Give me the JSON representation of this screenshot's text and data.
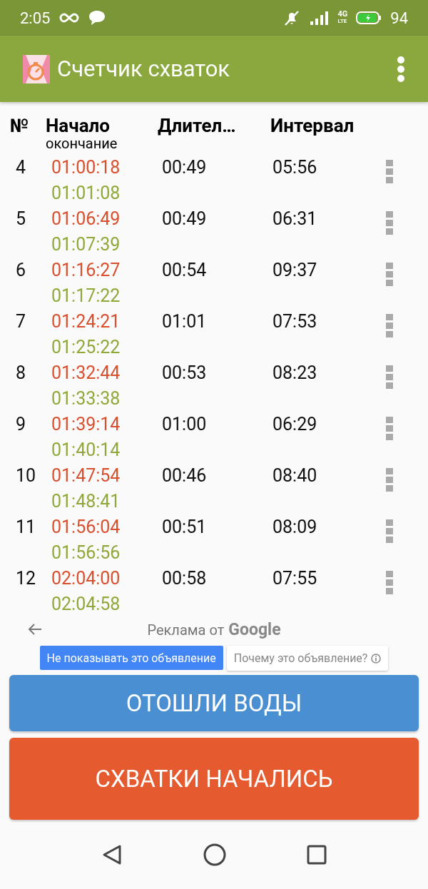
{
  "status_bar": {
    "time": "2:05",
    "network": "4G",
    "network_sub": "LTE",
    "battery": "94"
  },
  "app_bar": {
    "title": "Счетчик схваток"
  },
  "table": {
    "columns": [
      {
        "label": "№"
      },
      {
        "label": "Начало",
        "sublabel": "окончание"
      },
      {
        "label": "Длител…"
      },
      {
        "label": "Интервал"
      }
    ],
    "rows": [
      {
        "number": "4",
        "start": "01:00:18",
        "end": "01:01:08",
        "duration": "00:49",
        "interval": "05:56"
      },
      {
        "number": "5",
        "start": "01:06:49",
        "end": "01:07:39",
        "duration": "00:49",
        "interval": "06:31"
      },
      {
        "number": "6",
        "start": "01:16:27",
        "end": "01:17:22",
        "duration": "00:54",
        "interval": "09:37"
      },
      {
        "number": "7",
        "start": "01:24:21",
        "end": "01:25:22",
        "duration": "01:01",
        "interval": "07:53"
      },
      {
        "number": "8",
        "start": "01:32:44",
        "end": "01:33:38",
        "duration": "00:53",
        "interval": "08:23"
      },
      {
        "number": "9",
        "start": "01:39:14",
        "end": "01:40:14",
        "duration": "01:00",
        "interval": "06:29"
      },
      {
        "number": "10",
        "start": "01:47:54",
        "end": "01:48:41",
        "duration": "00:46",
        "interval": "08:40"
      },
      {
        "number": "11",
        "start": "01:56:04",
        "end": "01:56:56",
        "duration": "00:51",
        "interval": "08:09"
      },
      {
        "number": "12",
        "start": "02:04:00",
        "end": "02:04:58",
        "duration": "00:58",
        "interval": "07:55"
      }
    ]
  },
  "ad": {
    "label": "Реклама от",
    "brand": "Google",
    "hide_button": "Не показывать это объявление",
    "why_button": "Почему это объявление?"
  },
  "buttons": [
    {
      "label": "ОТОШЛИ ВОДЫ",
      "kind": "blue"
    },
    {
      "label": "СХВАТКИ НАЧАЛИСЬ",
      "kind": "orange"
    }
  ]
}
